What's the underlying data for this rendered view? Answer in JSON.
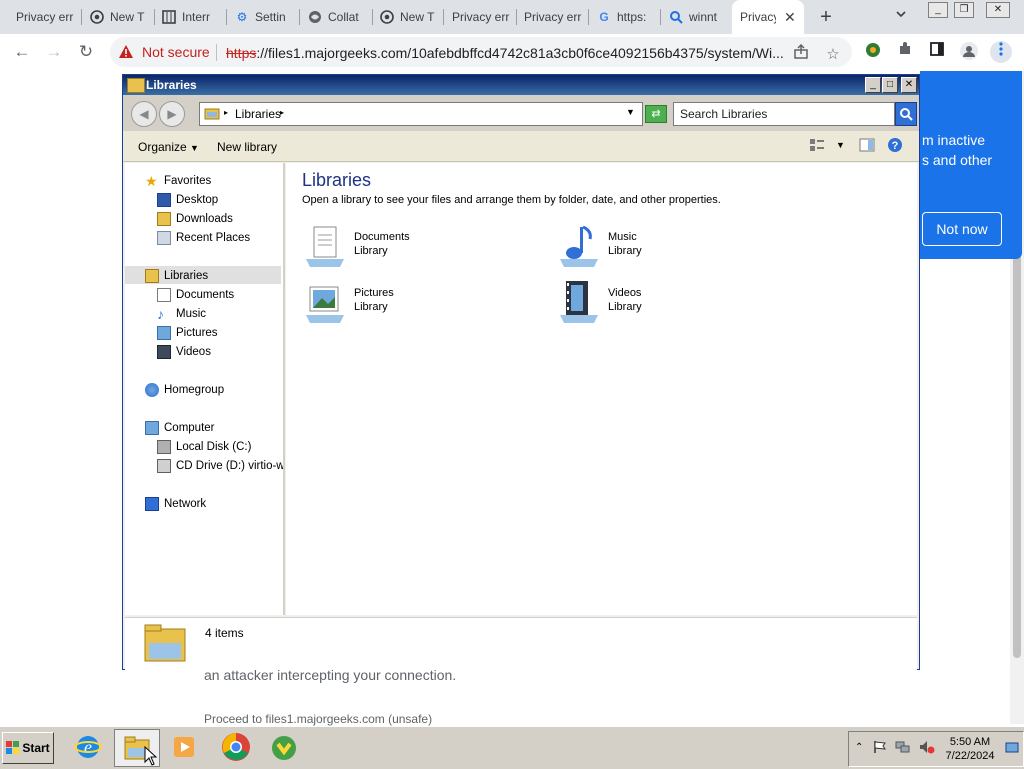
{
  "browser": {
    "tabs": [
      {
        "label": "Privacy err",
        "icon": "none"
      },
      {
        "label": "New T",
        "icon": "chrome-icon"
      },
      {
        "label": "Interr",
        "icon": "film-icon"
      },
      {
        "label": "Settin",
        "icon": "gear-icon"
      },
      {
        "label": "Collat",
        "icon": "globe-icon"
      },
      {
        "label": "New T",
        "icon": "chrome-icon"
      },
      {
        "label": "Privacy err",
        "icon": "none"
      },
      {
        "label": "Privacy err",
        "icon": "none"
      },
      {
        "label": "https:",
        "icon": "google-icon"
      },
      {
        "label": "winnt",
        "icon": "search-icon"
      },
      {
        "label": "Privacy",
        "icon": "none",
        "active": true
      }
    ],
    "new_tab": "+",
    "security_label": "Not secure",
    "url_scheme": "https",
    "url_rest": "://files1.majorgeeks.com/10afebdbffcd4742c81a3cb0f6ce4092156b4375/system/Wi..."
  },
  "page": {
    "popup_text": "m inactive\ns and other",
    "popup_button": "Not now",
    "bg_line1": "an attacker intercepting your connection.",
    "bg_line2": "Proceed to files1.majorgeeks.com (unsafe)"
  },
  "explorer": {
    "title": "Libraries",
    "address": "Libraries",
    "search_placeholder": "Search Libraries",
    "commands": {
      "organize": "Organize",
      "new_library": "New library"
    },
    "nav": {
      "favorites": "Favorites",
      "desktop": "Desktop",
      "downloads": "Downloads",
      "recent": "Recent Places",
      "libraries": "Libraries",
      "documents": "Documents",
      "music": "Music",
      "pictures": "Pictures",
      "videos": "Videos",
      "homegroup": "Homegroup",
      "computer": "Computer",
      "local_disk": "Local Disk (C:)",
      "cd_drive": "CD Drive (D:) virtio-wi",
      "network": "Network"
    },
    "content_title": "Libraries",
    "content_subtitle": "Open a library to see your files and arrange them by folder, date, and other properties.",
    "libraries": [
      {
        "name": "Documents",
        "type": "Library"
      },
      {
        "name": "Music",
        "type": "Library"
      },
      {
        "name": "Pictures",
        "type": "Library"
      },
      {
        "name": "Videos",
        "type": "Library"
      }
    ],
    "item_count": "4 items"
  },
  "taskbar": {
    "start": "Start",
    "time": "5:50 AM",
    "date": "7/22/2024"
  },
  "colors": {
    "title_gradient_start": "#0a246a",
    "title_gradient_end": "#3a6ea5",
    "popup_blue": "#1a73e8",
    "not_secure_red": "#c5221f"
  }
}
